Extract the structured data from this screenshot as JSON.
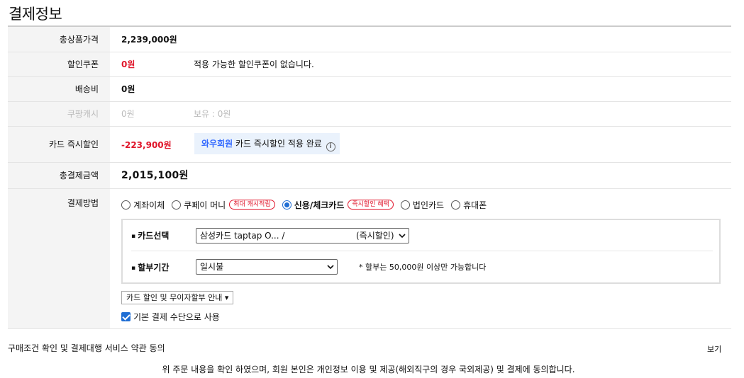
{
  "title": "결제정보",
  "rows": {
    "product_price": {
      "label": "총상품가격",
      "value": "2,239,000원"
    },
    "coupon": {
      "label": "할인쿠폰",
      "value": "0원",
      "note": "적용 가능한 할인쿠폰이 없습니다."
    },
    "shipping": {
      "label": "배송비",
      "value": "0원"
    },
    "coupang_cash": {
      "label": "쿠팡캐시",
      "value": "0원",
      "note": "보유 : 0원"
    },
    "card_discount": {
      "label": "카드 즉시할인",
      "value": "-223,900원",
      "badge_highlight": "와우회원",
      "badge_text": " 카드 즉시할인 적용 완료"
    },
    "total": {
      "label": "총결제금액",
      "value": "2,015,100원"
    },
    "payment_method": {
      "label": "결제방법"
    }
  },
  "payment_options": [
    {
      "label": "계좌이체",
      "selected": false
    },
    {
      "label": "쿠페이 머니",
      "selected": false,
      "tag": "최대 캐시적립"
    },
    {
      "label": "신용/체크카드",
      "selected": true,
      "tag": "즉시할인 혜택"
    },
    {
      "label": "법인카드",
      "selected": false
    },
    {
      "label": "휴대폰",
      "selected": false
    }
  ],
  "card_select": {
    "label": "카드선택",
    "value": "삼성카드 taptap O... /",
    "suffix": "(즉시할인)"
  },
  "installment": {
    "label": "할부기간",
    "value": "일시불",
    "note": "* 할부는 50,000원 이상만 가능합니다"
  },
  "guide_button": "카드 할인 및 무이자할부 안내 ▾",
  "default_payment": {
    "label": "기본 결제 수단으로 사용",
    "checked": true
  },
  "terms": {
    "label": "구매조건 확인 및 결제대행 서비스 약관 동의",
    "view": "보기"
  },
  "agreement": "위 주문 내용을 확인 하였으며, 회원 본인은 개인정보 이용 및 제공(해외직구의 경우 국외제공) 및 결제에 동의합니다.",
  "colors": {
    "discount_red": "#e0162b",
    "accent_blue": "#346aff",
    "radio_blue": "#1f6ed4",
    "header_bg": "#f4f4f4"
  }
}
